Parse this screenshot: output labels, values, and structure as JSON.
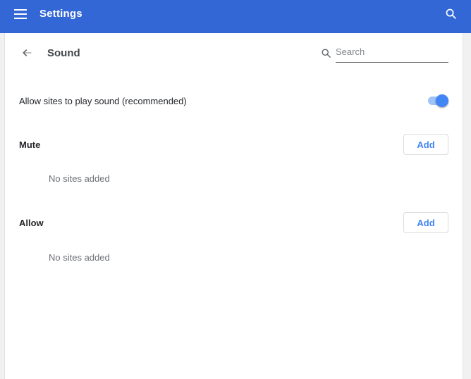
{
  "header": {
    "title": "Settings",
    "icons": {
      "menu": "menu-icon",
      "search": "search-icon"
    }
  },
  "subpage": {
    "title": "Sound",
    "back_icon": "back-arrow-icon",
    "search": {
      "placeholder": "Search",
      "value": "",
      "icon": "search-icon"
    }
  },
  "toggle_row": {
    "label": "Allow sites to play sound (recommended)",
    "enabled": true
  },
  "sections": [
    {
      "label": "Mute",
      "action_label": "Add",
      "empty_text": "No sites added"
    },
    {
      "label": "Allow",
      "action_label": "Add",
      "empty_text": "No sites added"
    }
  ],
  "colors": {
    "header_blue": "#3367d6",
    "accent_blue": "#4285f4",
    "toggle_track": "#9fc3f8",
    "page_bg": "#f1f1f1",
    "button_border": "#dadce0",
    "text_primary": "#25272b",
    "text_secondary": "#6e7175"
  }
}
